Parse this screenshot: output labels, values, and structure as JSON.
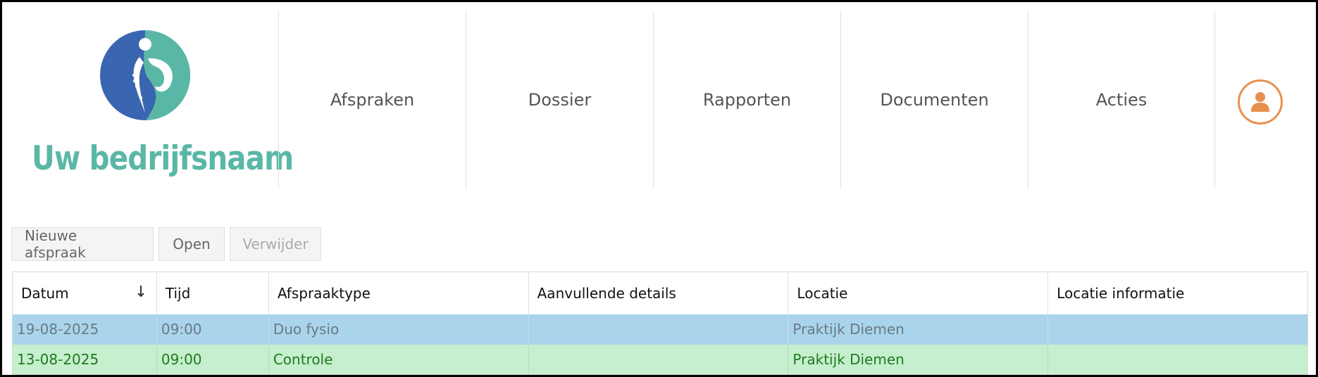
{
  "brand": {
    "company_name": "Uw bedrijfsnaam",
    "colors": {
      "teal": "#5ab7a6",
      "blue": "#3a65b0"
    },
    "logo_icon": "physio-figure-logo"
  },
  "nav": {
    "items": [
      {
        "label": "Afspraken"
      },
      {
        "label": "Dossier"
      },
      {
        "label": "Rapporten"
      },
      {
        "label": "Documenten"
      },
      {
        "label": "Acties"
      }
    ],
    "user_icon": "user-icon",
    "accent": "#e8904f"
  },
  "toolbar": {
    "new_label": "Nieuwe afspraak",
    "open_label": "Open",
    "delete_label": "Verwijder"
  },
  "table": {
    "headers": {
      "datum": "Datum",
      "tijd": "Tijd",
      "afspraaktype": "Afspraaktype",
      "details": "Aanvullende details",
      "locatie": "Locatie",
      "locatie_info": "Locatie informatie"
    },
    "sort_icon": "arrow-down-icon",
    "rows": [
      {
        "datum": "19-08-2025",
        "tijd": "09:00",
        "afspraaktype": "Duo fysio",
        "details": "",
        "locatie": "Praktijk Diemen",
        "locatie_info": "",
        "color": "#a9d4ec"
      },
      {
        "datum": "13-08-2025",
        "tijd": "09:00",
        "afspraaktype": "Controle",
        "details": "",
        "locatie": "Praktijk Diemen",
        "locatie_info": "",
        "color": "#c6efce"
      }
    ]
  }
}
